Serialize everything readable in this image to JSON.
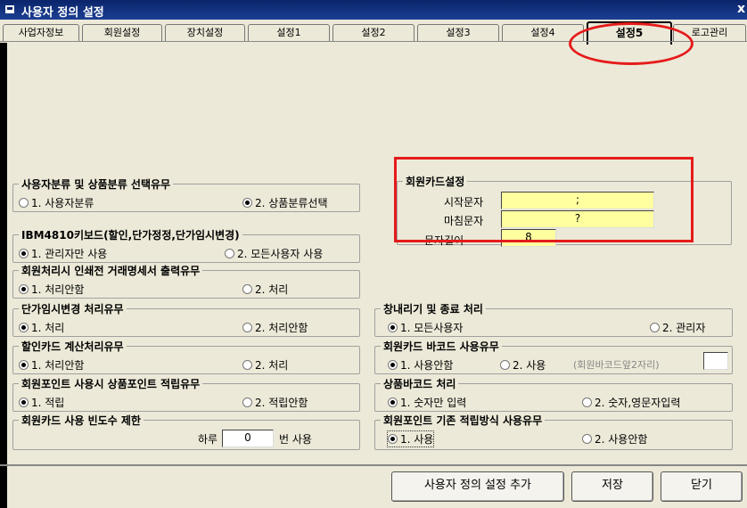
{
  "window": {
    "title": "사용자 정의 설정",
    "close": "x"
  },
  "tabs": [
    {
      "label": "사업자정보"
    },
    {
      "label": "회원설정"
    },
    {
      "label": "장치설정"
    },
    {
      "label": "설정1"
    },
    {
      "label": "설정2"
    },
    {
      "label": "설정3"
    },
    {
      "label": "설정4"
    },
    {
      "label": "설정5",
      "active": true
    },
    {
      "label": "로고관리"
    }
  ],
  "groups": {
    "classify": {
      "title": "사용자분류 및 상품분류 선택유무",
      "opt1": "1. 사용자분류",
      "opt2": "2. 상품분류선택",
      "selected": 2
    },
    "ibm": {
      "title": "IBM4810키보드(할인,단가정정,단가임시변경)",
      "opt1": "1. 관리자만 사용",
      "opt2": "2. 모든사용자 사용",
      "selected": 1
    },
    "member_print": {
      "title": "회원처리시 인쇄전 거래명세서 출력유무",
      "opt1": "1. 처리안함",
      "opt2": "2. 처리",
      "selected": 1
    },
    "price_change": {
      "title": "단가임시변경 처리유무",
      "opt1": "1. 처리",
      "opt2": "2. 처리안함",
      "selected": 1
    },
    "discount_card": {
      "title": "할인카드 계산처리유무",
      "opt1": "1. 처리안함",
      "opt2": "2. 처리",
      "selected": 1
    },
    "member_point": {
      "title": "회원포인트 사용시 상품포인트 적립유무",
      "opt1": "1. 적립",
      "opt2": "2. 적립안함",
      "selected": 1
    },
    "card_limit": {
      "title": "회원카드 사용 빈도수 제한",
      "prefix": "하루",
      "value": "0",
      "suffix": "번 사용"
    },
    "card_setting": {
      "title": "회원카드설정",
      "start_label": "시작문자",
      "start_value": ";",
      "end_label": "마침문자",
      "end_value": "?",
      "len_label": "문자길이",
      "len_value": "8"
    },
    "window_exit": {
      "title": "창내리기 및 종료 처리",
      "opt1": "1. 모든사용자",
      "opt2": "2. 관리자",
      "selected": 1
    },
    "card_barcode": {
      "title": "회원카드 바코드 사용유무",
      "opt1": "1. 사용안함",
      "opt2": "2. 사용",
      "opt2_hint": "(회원바코드앞2자리)",
      "selected": 1
    },
    "product_barcode": {
      "title": "상품바코드 처리",
      "opt1": "1. 숫자만 입력",
      "opt2": "2. 숫자,영문자입력",
      "selected": 1
    },
    "point_basis": {
      "title": "회원포인트 기존 적립방식 사용유무",
      "opt1": "1. 사용",
      "opt2": "2. 사용안함",
      "selected": 1
    }
  },
  "buttons": {
    "add": "사용자 정의 설정 추가",
    "save": "저장",
    "close": "닫기"
  },
  "colors": {
    "highlight": "#e51b1b",
    "field_bg": "#ffffa0",
    "titlebar": "#0a246a"
  }
}
